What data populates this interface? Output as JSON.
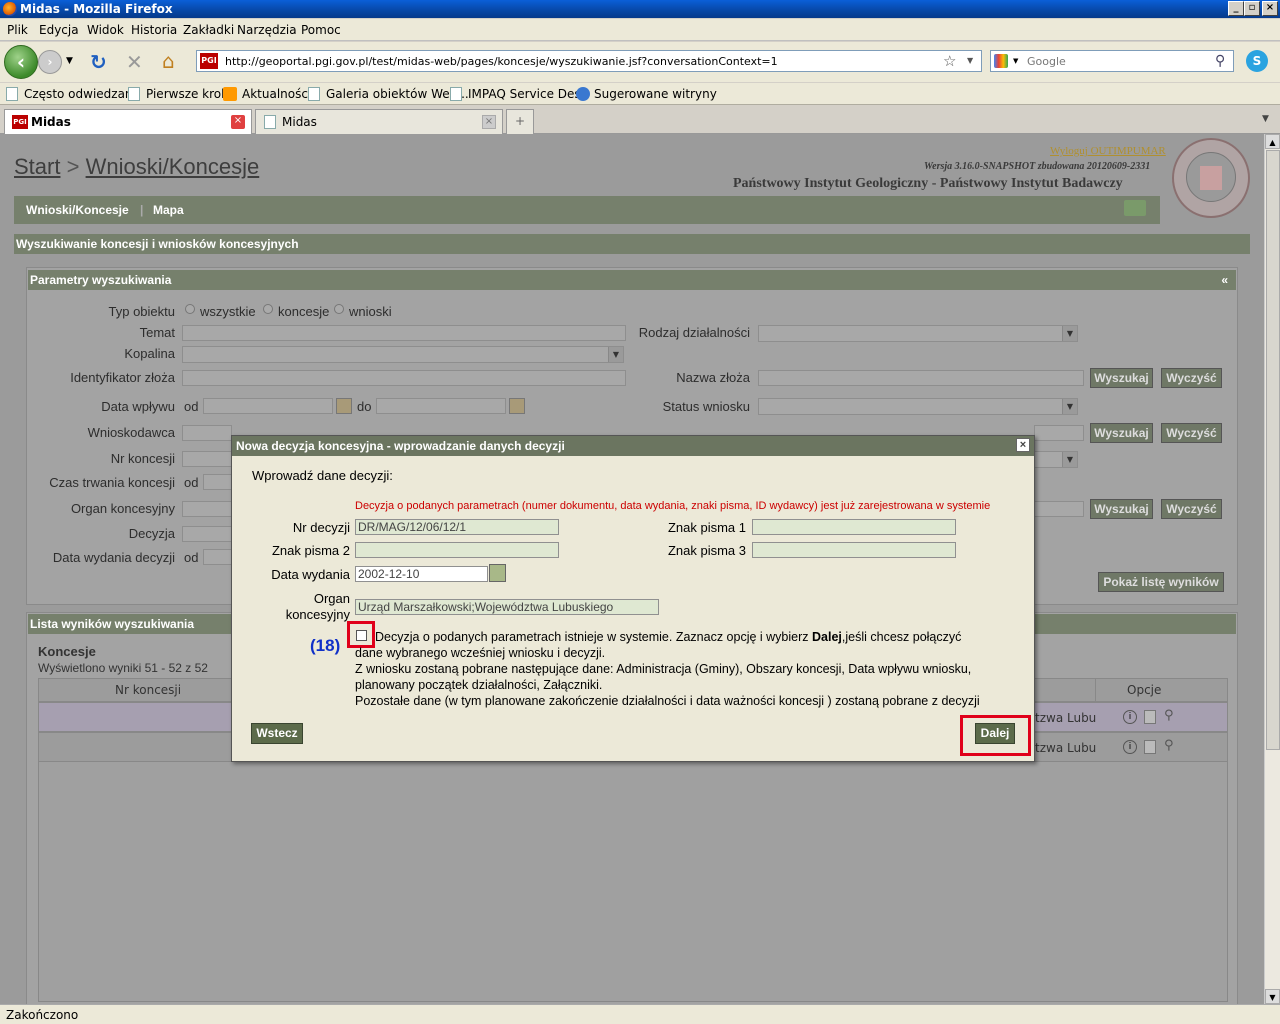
{
  "window": {
    "title": "Midas - Mozilla Firefox"
  },
  "menu": [
    "Plik",
    "Edycja",
    "Widok",
    "Historia",
    "Zakładki",
    "Narzędzia",
    "Pomoc"
  ],
  "nav": {
    "url": "http://geoportal.pgi.gov.pl/test/midas-web/pages/koncesje/wyszukiwanie.jsf?conversationContext=1",
    "search_placeholder": "Google"
  },
  "bookmarks": [
    "Często odwiedzane",
    "Pierwsze kroki",
    "Aktualności",
    "Galeria obiektów Web...",
    "IMPAQ Service Desk",
    "Sugerowane witryny"
  ],
  "tabs": [
    {
      "label": "Midas"
    },
    {
      "label": "Midas"
    }
  ],
  "status": "Zakończono",
  "header": {
    "crumb_start": "Start",
    "crumb_sep": ">",
    "crumb_current": "Wnioski/Koncesje",
    "logout": "Wyloguj OUTIMPUMAR",
    "version": "Wersja 3.16.0-SNAPSHOT zbudowana 20120609-2331",
    "institute": "Państwowy Instytut Geologiczny - Państwowy Instytut Badawczy"
  },
  "nav_tabs": [
    "Wnioski/Koncesje",
    "Mapa"
  ],
  "section_title": "Wyszukiwanie koncesji i wniosków koncesyjnych",
  "params": {
    "title": "Parametry wyszukiwania",
    "collapse": "«",
    "typ_obiektu": "Typ obiektu",
    "radio_all": "wszystkie",
    "radio_koncesje": "koncesje",
    "radio_wnioski": "wnioski",
    "temat": "Temat",
    "rodzaj": "Rodzaj działalności",
    "kopalina": "Kopalina",
    "identyfikator": "Identyfikator złoża",
    "nazwa_zloza": "Nazwa złoża",
    "data_wplywu": "Data wpływu",
    "od": "od",
    "do": "do",
    "status_wniosku": "Status wniosku",
    "wnioskodawca": "Wnioskodawca",
    "nr_koncesji": "Nr koncesji",
    "czas_trwania": "Czas trwania koncesji",
    "organ": "Organ koncesyjny",
    "decyzja": "Decyzja",
    "data_wydania": "Data wydania decyzji",
    "btn_search": "Wyszukaj",
    "btn_clear": "Wyczyść",
    "btn_show": "Pokaż listę wyników"
  },
  "results": {
    "title": "Lista wyników wyszukiwania",
    "subtitle": "Koncesje",
    "count": "Wyświetlono wyniki 51 - 52 z 52",
    "col_nr": "Nr koncesji",
    "col_opcje": "Opcje",
    "row_text": "tzwa Lubu"
  },
  "modal": {
    "title": "Nowa decyzja koncesyjna - wprowadzanie danych decyzji",
    "close": "×",
    "intro": "Wprowadź dane decyzji:",
    "error": "Decyzja o podanych parametrach (numer dokumentu, data wydania, znaki pisma, ID wydawcy) jest już zarejestrowana w systemie",
    "nr_decyzji_label": "Nr decyzji",
    "nr_decyzji": "DR/MAG/12/06/12/1",
    "znak1_label": "Znak pisma 1",
    "znak2_label": "Znak pisma 2",
    "znak3_label": "Znak pisma 3",
    "data_label": "Data wydania",
    "data": "2002-12-10",
    "organ_label1": "Organ",
    "organ_label2": "koncesyjny",
    "organ": "Urząd Marszałkowski;Województwa Lubuskiego",
    "annotation": "(18)",
    "check_line1_a": "Decyzja o podanych parametrach istnieje w systemie. Zaznacz opcję i wybierz ",
    "check_line1_b": "Dalej",
    "check_line1_c": ",jeśli chcesz połączyć",
    "check_line2": "dane wybranego wcześniej wniosku i decyzji.",
    "check_line3": "Z wniosku zostaną pobrane następujące dane: Administracja (Gminy), Obszary koncesji, Data wpływu wniosku,",
    "check_line4": "planowany początek działalności, Załączniki.",
    "check_line5": "Pozostałe dane (w tym planowane zakończenie działalności i data ważności koncesji ) zostaną pobrane z decyzji",
    "btn_back": "Wstecz",
    "btn_next": "Dalej"
  },
  "colors": {
    "accent_green": "#6b7560",
    "error_red": "#cc0000",
    "highlight": "#e0001a",
    "annotation_blue": "#1030c8"
  }
}
